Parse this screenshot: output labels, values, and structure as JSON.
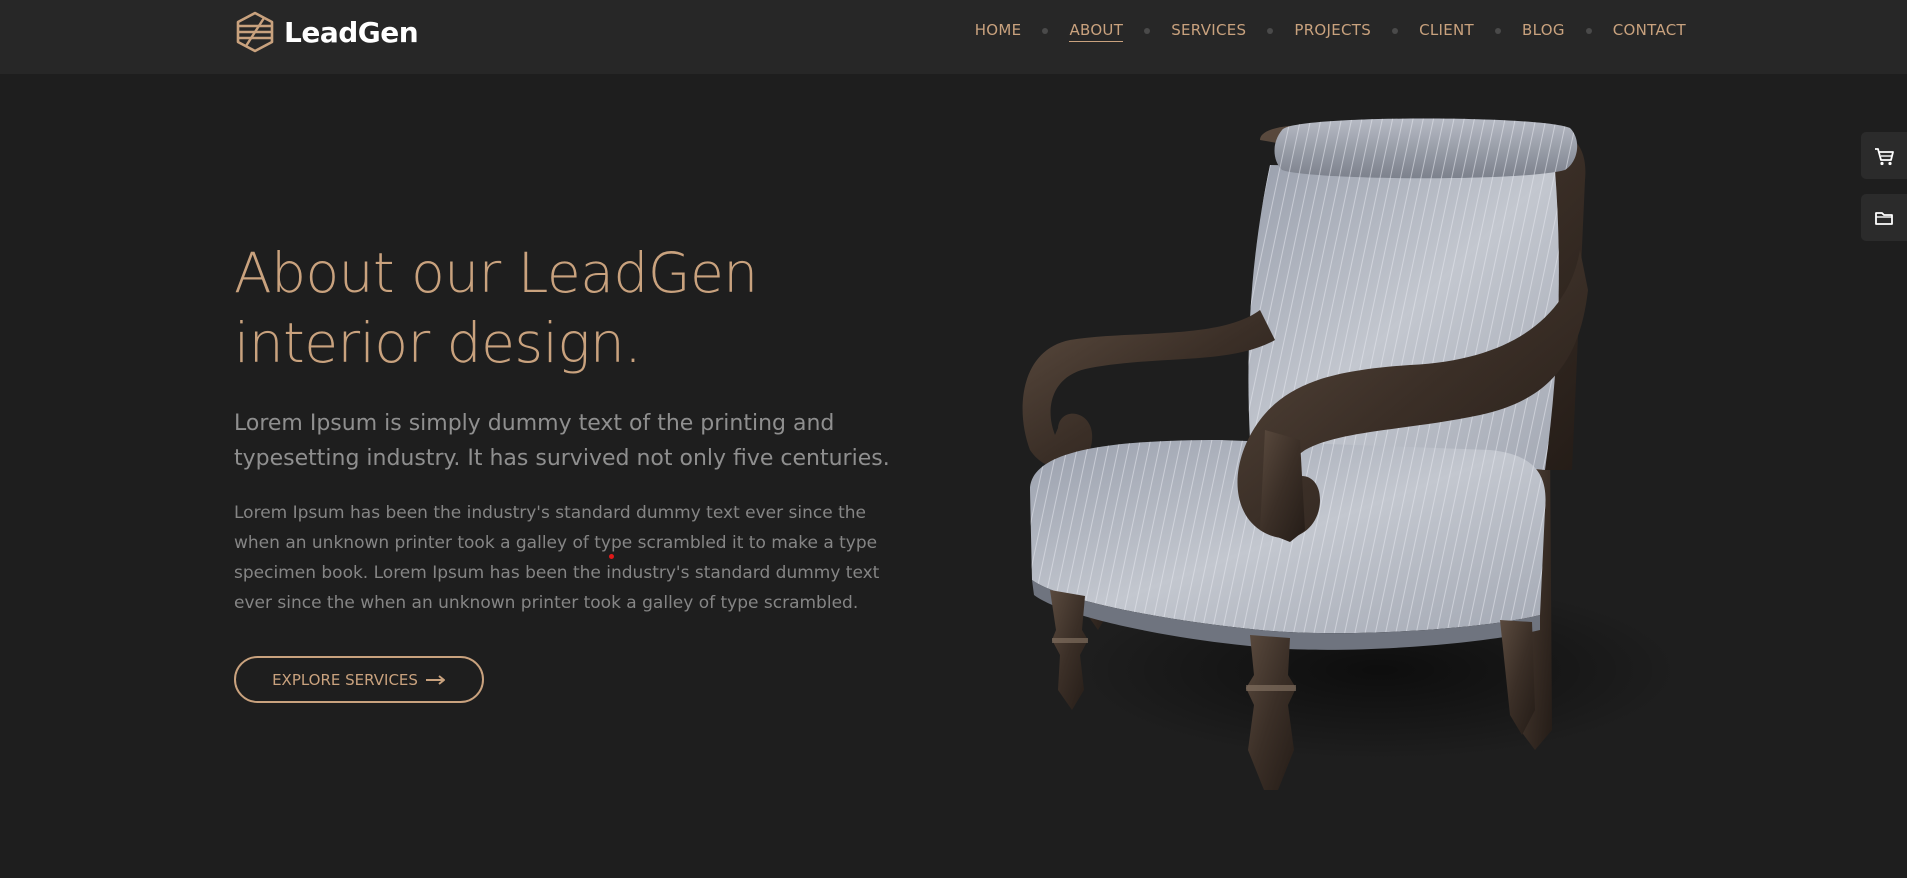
{
  "brand": {
    "name": "LeadGen"
  },
  "nav": {
    "items": [
      {
        "label": "HOME"
      },
      {
        "label": "ABOUT",
        "active": true
      },
      {
        "label": "SERVICES"
      },
      {
        "label": "PROJECTS"
      },
      {
        "label": "CLIENT"
      },
      {
        "label": "BLOG"
      },
      {
        "label": "CONTACT"
      }
    ]
  },
  "hero": {
    "title_line1": "About our LeadGen",
    "title_line2": "interior design.",
    "lead": "Lorem Ipsum is simply dummy text of the printing and typesetting industry. It has survived not only five centuries.",
    "body": "Lorem Ipsum has been the industry's standard dummy text ever since the when an unknown printer took a galley of type scrambled it to make a type specimen book. Lorem Ipsum has been the industry's standard dummy text ever since the when an unknown printer took a galley of type scrambled.",
    "cta_label": "EXPLORE SERVICES"
  },
  "side_widgets": [
    {
      "icon": "cart-icon"
    },
    {
      "icon": "folder-icon"
    }
  ],
  "colors": {
    "background": "#1e1e1e",
    "header": "#272727",
    "accent": "#c9a27e",
    "text_muted": "#8f8f8f"
  }
}
